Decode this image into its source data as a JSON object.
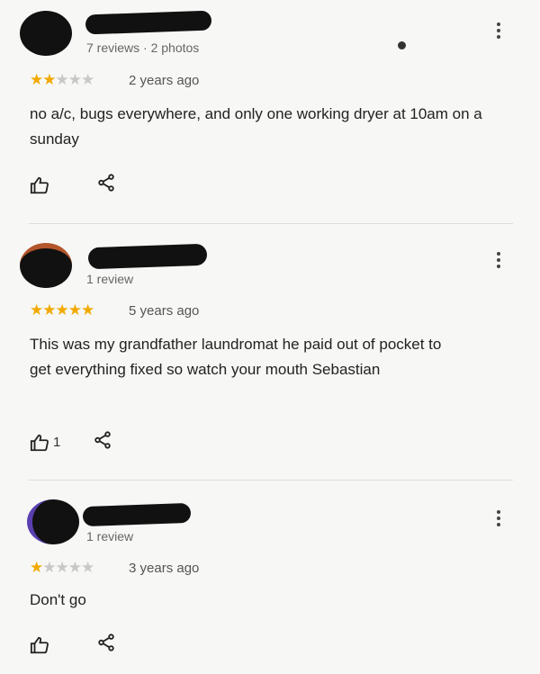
{
  "reviews": [
    {
      "meta": "7 reviews · 2 photos",
      "rating": 2,
      "age": "2 years ago",
      "text": "no a/c, bugs everywhere, and only one working dryer at 10am on a sunday",
      "like_count": ""
    },
    {
      "meta": "1 review",
      "rating": 5,
      "age": "5 years ago",
      "text": "This was my grandfather laundromat he paid out of pocket to get everything fixed so watch your mouth Sebastian",
      "like_count": "1"
    },
    {
      "meta": "1 review",
      "rating": 1,
      "age": "3 years ago",
      "text": "Don't go",
      "like_count": ""
    }
  ],
  "icons": {
    "like": "thumbs-up-icon",
    "share": "share-icon",
    "more": "more-vert-icon"
  },
  "colors": {
    "star_filled": "#f2a900",
    "star_empty": "#c8c8c8"
  }
}
